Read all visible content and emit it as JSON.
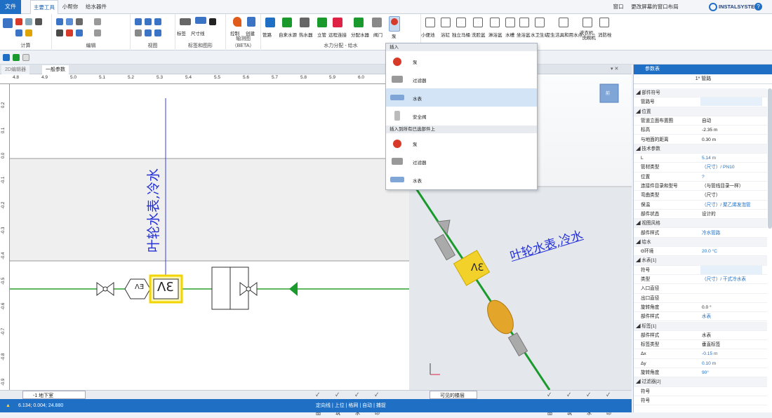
{
  "tabs": {
    "file": "文件",
    "main": "主要工具",
    "helper": "小帮你",
    "water": "给水器件"
  },
  "topright": {
    "window": "窗口",
    "layout": "更改屏幕的窗口布局",
    "brand": "INSTALSYSTEM"
  },
  "groups": {
    "calc": "计算",
    "edit": "编辑",
    "view": "视图",
    "label": "标签和图形",
    "axon": "轴测图（BETA）",
    "water": "水力分配 - 给水"
  },
  "buttons": {
    "label": "标签",
    "dim": "尺寸线",
    "ctrl": "控制",
    "create": "创建",
    "pipe": "管路",
    "source": "自来水源",
    "heater": "热水器",
    "riser": "立管",
    "remote": "远程连接",
    "manifold": "分配水器",
    "valve": "阀门",
    "pump": "泵",
    "sink": "小便池",
    "basin": "浴缸",
    "stand": "独立马桶",
    "wash": "洗脸盆",
    "bath": "淋浴盆",
    "tank": "水槽",
    "seat": "坐浴盆",
    "tap": "水卫生站",
    "fixture": "卫生洁具和用水点",
    "washer": "洗衣机、洗碗机",
    "fire": "消防栓"
  },
  "doc": {
    "tab1": "2D编辑器",
    "tab2": "一般参数"
  },
  "ruler": [
    "4.8",
    "4.9",
    "5.0",
    "5.1",
    "5.2",
    "5.3",
    "5.4",
    "5.5",
    "5.6",
    "5.7",
    "5.8",
    "5.9",
    "6.0",
    "6.1"
  ],
  "vruler": [
    "0.2",
    "0.1",
    "0.0",
    "-0.1",
    "-0.2",
    "-0.3",
    "-0.4",
    "-0.5",
    "-0.6",
    "-0.7",
    "-0.8",
    "-0.9"
  ],
  "drawing": {
    "label": "叶轮水表,冷水",
    "meter_sym": "ΛƐ",
    "hex_sym": "ΛƎ"
  },
  "view3d": {
    "label": "叶轮水表,冷水",
    "cube": "前",
    "meter_sym": "ΛƐ"
  },
  "dropdown": {
    "insert": "插入",
    "items": [
      "泵",
      "过滤器",
      "水表",
      "安全阀"
    ],
    "insert_all": "插入到所有已选部件上",
    "items2": [
      "泵",
      "过滤器",
      "水表"
    ]
  },
  "props": {
    "title": "参数表",
    "header": "1* 管路",
    "rows": [
      {
        "g": 1,
        "k": "部件符号"
      },
      {
        "k": "管路号",
        "v": "",
        "hl": 1
      },
      {
        "g": 1,
        "k": "位置"
      },
      {
        "k": "管道立面布置图",
        "v": "自动"
      },
      {
        "k": "标高",
        "v": "-2.35",
        "u": "m"
      },
      {
        "k": "与地面的距离",
        "v": "0.30",
        "u": "m"
      },
      {
        "g": 1,
        "k": "技术参数"
      },
      {
        "k": "L",
        "v": "5.14",
        "u": "m",
        "b": 1
      },
      {
        "k": "管材类型",
        "v": "（尺寸）/ PN10",
        "b": 1
      },
      {
        "k": "位置",
        "v": "?",
        "b": 1
      },
      {
        "k": "连接件目录和型号",
        "v": "（与管线目录一样）"
      },
      {
        "k": "弯曲类型",
        "v": "（尺寸）"
      },
      {
        "k": "保温",
        "v": "（尺寸）/ 聚乙烯发泡管",
        "b": 1
      },
      {
        "k": "部件状态",
        "v": "设计的"
      },
      {
        "g": 1,
        "k": "视图风格"
      },
      {
        "k": "部件样式",
        "v": "冷水管路",
        "b": 1
      },
      {
        "g": 1,
        "k": "给水"
      },
      {
        "k": "Θ环境",
        "v": "20.0",
        "u": "°C",
        "b": 1
      },
      {
        "g": 1,
        "k": "水表[1]"
      },
      {
        "k": "符号",
        "v": "",
        "hl": 1
      },
      {
        "k": "类型",
        "v": "（尺寸）/ 干式冷水表",
        "b": 1
      },
      {
        "k": "入口直径",
        "v": ""
      },
      {
        "k": "出口直径",
        "v": ""
      },
      {
        "k": "旋转角度",
        "v": "0.0",
        "u": "°"
      },
      {
        "k": "部件样式",
        "v": "水表",
        "b": 1
      },
      {
        "g": 1,
        "k": "标签[1]"
      },
      {
        "k": "部件样式",
        "v": "水表"
      },
      {
        "k": "标签类型",
        "v": "垂直标签"
      },
      {
        "k": "Δx",
        "v": "-0.15",
        "u": "m",
        "b": 1
      },
      {
        "k": "Δy",
        "v": "0.10",
        "u": "m",
        "b": 1
      },
      {
        "k": "旋转角度",
        "v": "90°",
        "b": 1
      },
      {
        "g": 1,
        "k": "过滤器[2]"
      },
      {
        "k": "符号",
        "v": ""
      },
      {
        "k": "符号",
        "v": ""
      }
    ]
  },
  "bottom": {
    "floor": "-1 地下室",
    "tabs": [
      "底图",
      "建筑",
      "给水",
      "打印"
    ],
    "visible": "可见的楼层",
    "tabs3d": [
      "底图",
      "建筑",
      "给水",
      "打印"
    ]
  },
  "status": {
    "coords": "6.134; 0.004; 24.880",
    "modes": "定向线 | 上位 | 格网 | 自动 | 捕捉"
  },
  "colors": {
    "accent": "#1f6fc4",
    "pipe": "#1a9a2c",
    "label": "#2430d8",
    "meter": "#f2d22a"
  }
}
